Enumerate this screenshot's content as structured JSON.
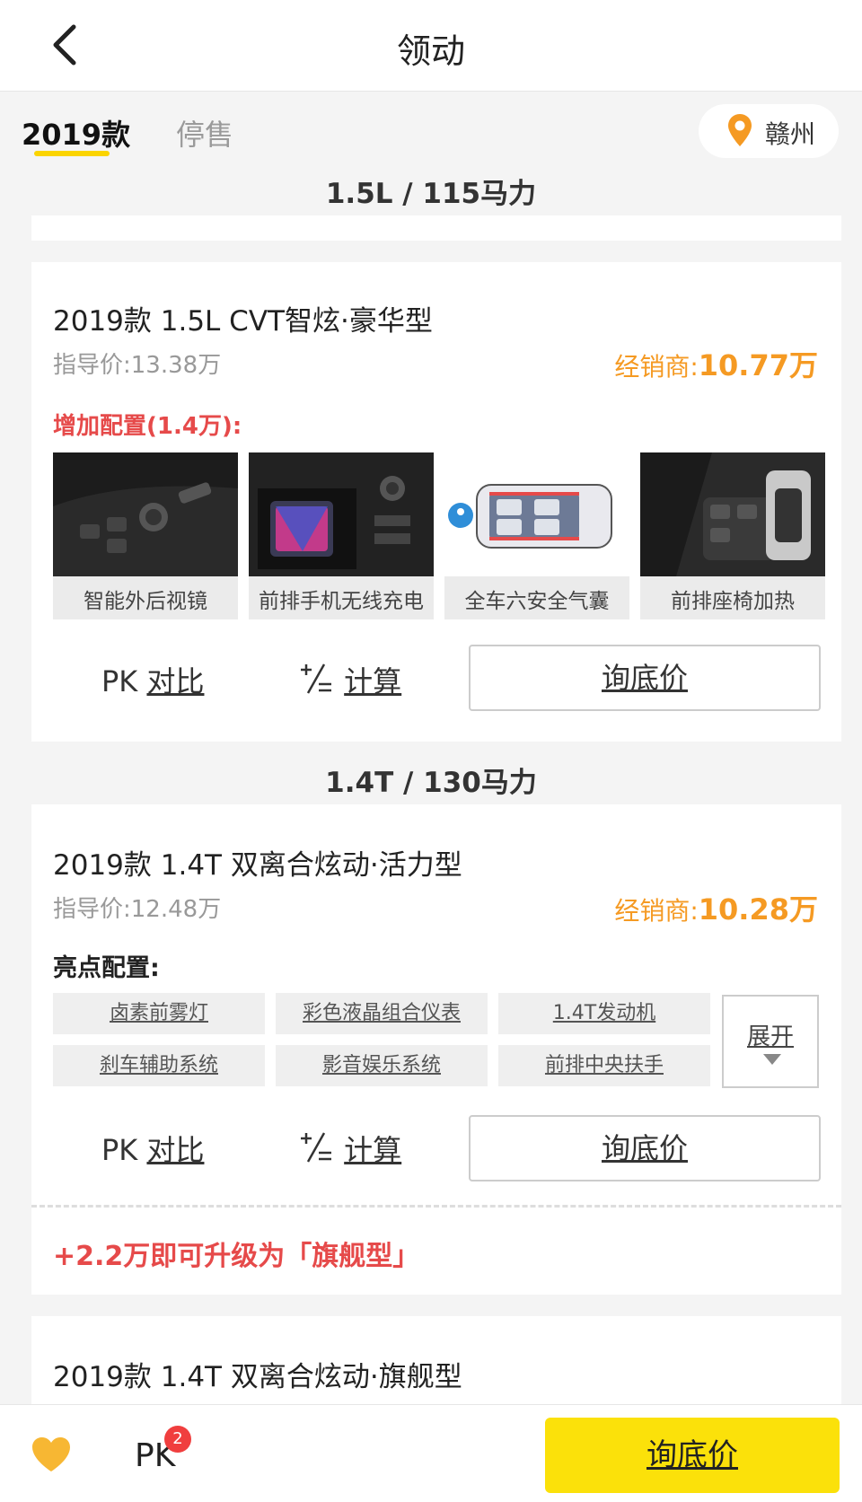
{
  "header": {
    "title": "领动"
  },
  "tabs": [
    {
      "label": "2019款",
      "active": true
    },
    {
      "label": "停售",
      "active": false
    }
  ],
  "city": {
    "label": "赣州"
  },
  "sections": [
    {
      "title": "1.5L / 115马力"
    },
    {
      "title": "1.4T / 130马力"
    }
  ],
  "cards": [
    {
      "name": "2019款 1.5L CVT智炫·豪华型",
      "guide_price": "指导价:13.38万",
      "dealer_label": "经销商:",
      "dealer_value": "10.77万",
      "added_config": "增加配置(1.4万):",
      "features": [
        {
          "label": "智能外后视镜",
          "icon": "mirror-control-photo"
        },
        {
          "label": "前排手机无线充电",
          "icon": "wireless-charging-photo"
        },
        {
          "label": "全车六安全气囊",
          "icon": "airbag-diagram"
        },
        {
          "label": "前排座椅加热",
          "icon": "seat-heating-photo"
        }
      ],
      "pk_prefix": "PK ",
      "pk_link": "对比",
      "calc_link": "计算",
      "inquiry": "询底价"
    },
    {
      "name": "2019款 1.4T 双离合炫动·活力型",
      "guide_price": "指导价:12.48万",
      "dealer_label": "经销商:",
      "dealer_value": "10.28万",
      "highlights_title": "亮点配置:",
      "tags": [
        "卤素前雾灯",
        "彩色液晶组合仪表",
        "1.4T发动机",
        "刹车辅助系统",
        "影音娱乐系统",
        "前排中央扶手"
      ],
      "expand": "展开",
      "pk_prefix": "PK ",
      "pk_link": "对比",
      "calc_link": "计算",
      "inquiry": "询底价",
      "upgrade": "+2.2万即可升级为「旗舰型」"
    },
    {
      "name": "2019款 1.4T 双离合炫动·旗舰型"
    }
  ],
  "bottom": {
    "pk_label": "PK",
    "pk_badge": "2",
    "inquiry": "询底价"
  },
  "colors": {
    "accent_yellow": "#fbe10a",
    "price_orange": "#f59a23",
    "alert_red": "#e64a4a"
  }
}
